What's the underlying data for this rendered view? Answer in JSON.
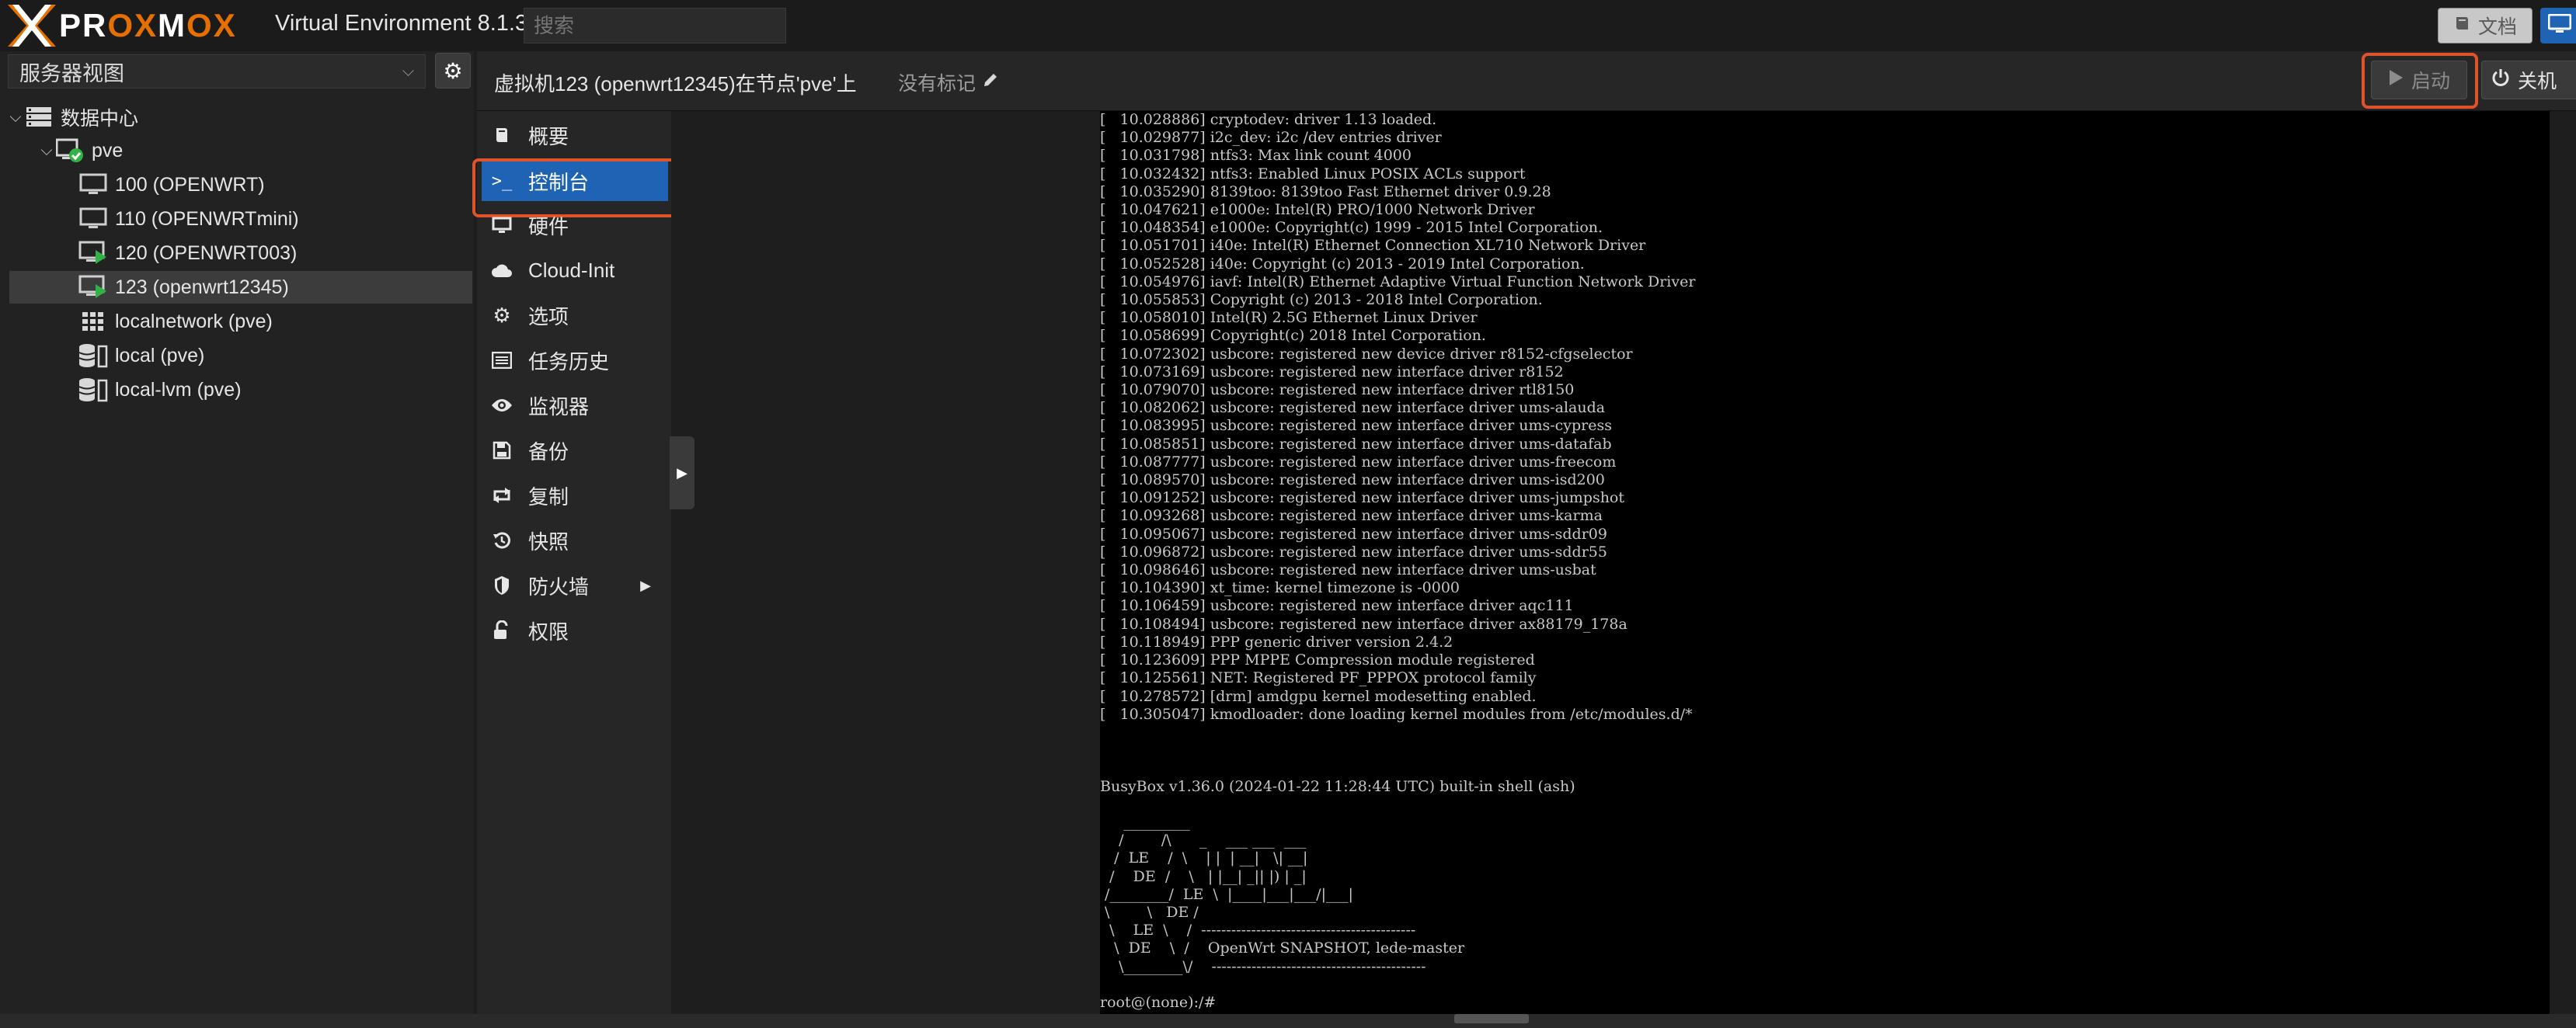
{
  "app": {
    "logo_text": "PROXMOX",
    "version": "Virtual Environment 8.1.3",
    "search_placeholder": "搜索",
    "docs_label": "文档",
    "colors": {
      "accent": "#1e63b4",
      "brand_orange": "#e57000",
      "highlight_box": "#e0522a",
      "running_green": "#2fb344"
    }
  },
  "sidebar": {
    "view_select": "服务器视图",
    "tree": [
      {
        "label": "数据中心",
        "icon": "datacenter-icon",
        "level": 0
      },
      {
        "label": "pve",
        "icon": "node-online-icon",
        "level": 1
      },
      {
        "label": "100 (OPENWRT)",
        "icon": "vm-stopped-icon",
        "level": 2
      },
      {
        "label": "110 (OPENWRTmini)",
        "icon": "vm-stopped-icon",
        "level": 2
      },
      {
        "label": "120 (OPENWRT003)",
        "icon": "vm-running-icon",
        "level": 2
      },
      {
        "label": "123 (openwrt12345)",
        "icon": "vm-running-icon",
        "level": 2,
        "selected": true
      },
      {
        "label": "localnetwork (pve)",
        "icon": "sdn-grid-icon",
        "level": 2
      },
      {
        "label": "local (pve)",
        "icon": "storage-icon",
        "level": 2
      },
      {
        "label": "local-lvm (pve)",
        "icon": "storage-icon",
        "level": 2
      }
    ]
  },
  "header": {
    "title": "虚拟机123 (openwrt12345)在节点'pve'上",
    "tags_label": "没有标记",
    "start_label": "启动",
    "shutdown_label": "关机"
  },
  "vm_menu": [
    {
      "label": "概要",
      "icon": "book-icon"
    },
    {
      "label": "控制台",
      "icon": "terminal-icon",
      "selected": true
    },
    {
      "label": "硬件",
      "icon": "desktop-icon"
    },
    {
      "label": "Cloud-Init",
      "icon": "cloud-icon"
    },
    {
      "label": "选项",
      "icon": "gear-icon"
    },
    {
      "label": "任务历史",
      "icon": "list-icon"
    },
    {
      "label": "监视器",
      "icon": "eye-icon"
    },
    {
      "label": "备份",
      "icon": "floppy-icon"
    },
    {
      "label": "复制",
      "icon": "retweet-icon"
    },
    {
      "label": "快照",
      "icon": "history-icon"
    },
    {
      "label": "防火墙",
      "icon": "shield-icon",
      "submenu": true
    },
    {
      "label": "权限",
      "icon": "unlock-icon"
    }
  ],
  "console": {
    "text": "[   10.028886] cryptodev: driver 1.13 loaded.\n[   10.029877] i2c_dev: i2c /dev entries driver\n[   10.031798] ntfs3: Max link count 4000\n[   10.032432] ntfs3: Enabled Linux POSIX ACLs support\n[   10.035290] 8139too: 8139too Fast Ethernet driver 0.9.28\n[   10.047621] e1000e: Intel(R) PRO/1000 Network Driver\n[   10.048354] e1000e: Copyright(c) 1999 - 2015 Intel Corporation.\n[   10.051701] i40e: Intel(R) Ethernet Connection XL710 Network Driver\n[   10.052528] i40e: Copyright (c) 2013 - 2019 Intel Corporation.\n[   10.054976] iavf: Intel(R) Ethernet Adaptive Virtual Function Network Driver\n[   10.055853] Copyright (c) 2013 - 2018 Intel Corporation.\n[   10.058010] Intel(R) 2.5G Ethernet Linux Driver\n[   10.058699] Copyright(c) 2018 Intel Corporation.\n[   10.072302] usbcore: registered new device driver r8152-cfgselector\n[   10.073169] usbcore: registered new interface driver r8152\n[   10.079070] usbcore: registered new interface driver rtl8150\n[   10.082062] usbcore: registered new interface driver ums-alauda\n[   10.083995] usbcore: registered new interface driver ums-cypress\n[   10.085851] usbcore: registered new interface driver ums-datafab\n[   10.087777] usbcore: registered new interface driver ums-freecom\n[   10.089570] usbcore: registered new interface driver ums-isd200\n[   10.091252] usbcore: registered new interface driver ums-jumpshot\n[   10.093268] usbcore: registered new interface driver ums-karma\n[   10.095067] usbcore: registered new interface driver ums-sddr09\n[   10.096872] usbcore: registered new interface driver ums-sddr55\n[   10.098646] usbcore: registered new interface driver ums-usbat\n[   10.104390] xt_time: kernel timezone is -0000\n[   10.106459] usbcore: registered new interface driver aqc111\n[   10.108494] usbcore: registered new interface driver ax88179_178a\n[   10.118949] PPP generic driver version 2.4.2\n[   10.123609] PPP MPPE Compression module registered\n[   10.125561] NET: Registered PF_PPPOX protocol family\n[   10.278572] [drm] amdgpu kernel modesetting enabled.\n[   10.305047] kmodloader: done loading kernel modules from /etc/modules.d/*\n\n\n\nBusyBox v1.36.0 (2024-01-22 11:28:44 UTC) built-in shell (ash)\n\n     _________\n    /        /\\      _    ___ ___  ___\n   /  LE    /  \\    | |  | __|   \\| __|\n  /    DE  /    \\   | |__| _|| |) | _|\n /________/  LE  \\  |____|___|___/|___|\n \\        \\   DE /\n  \\    LE  \\    /  -------------------------------------------\n   \\  DE    \\  /    OpenWrt SNAPSHOT, lede-master\n    \\________\\/    -------------------------------------------\n\nroot@(none):/#"
  }
}
